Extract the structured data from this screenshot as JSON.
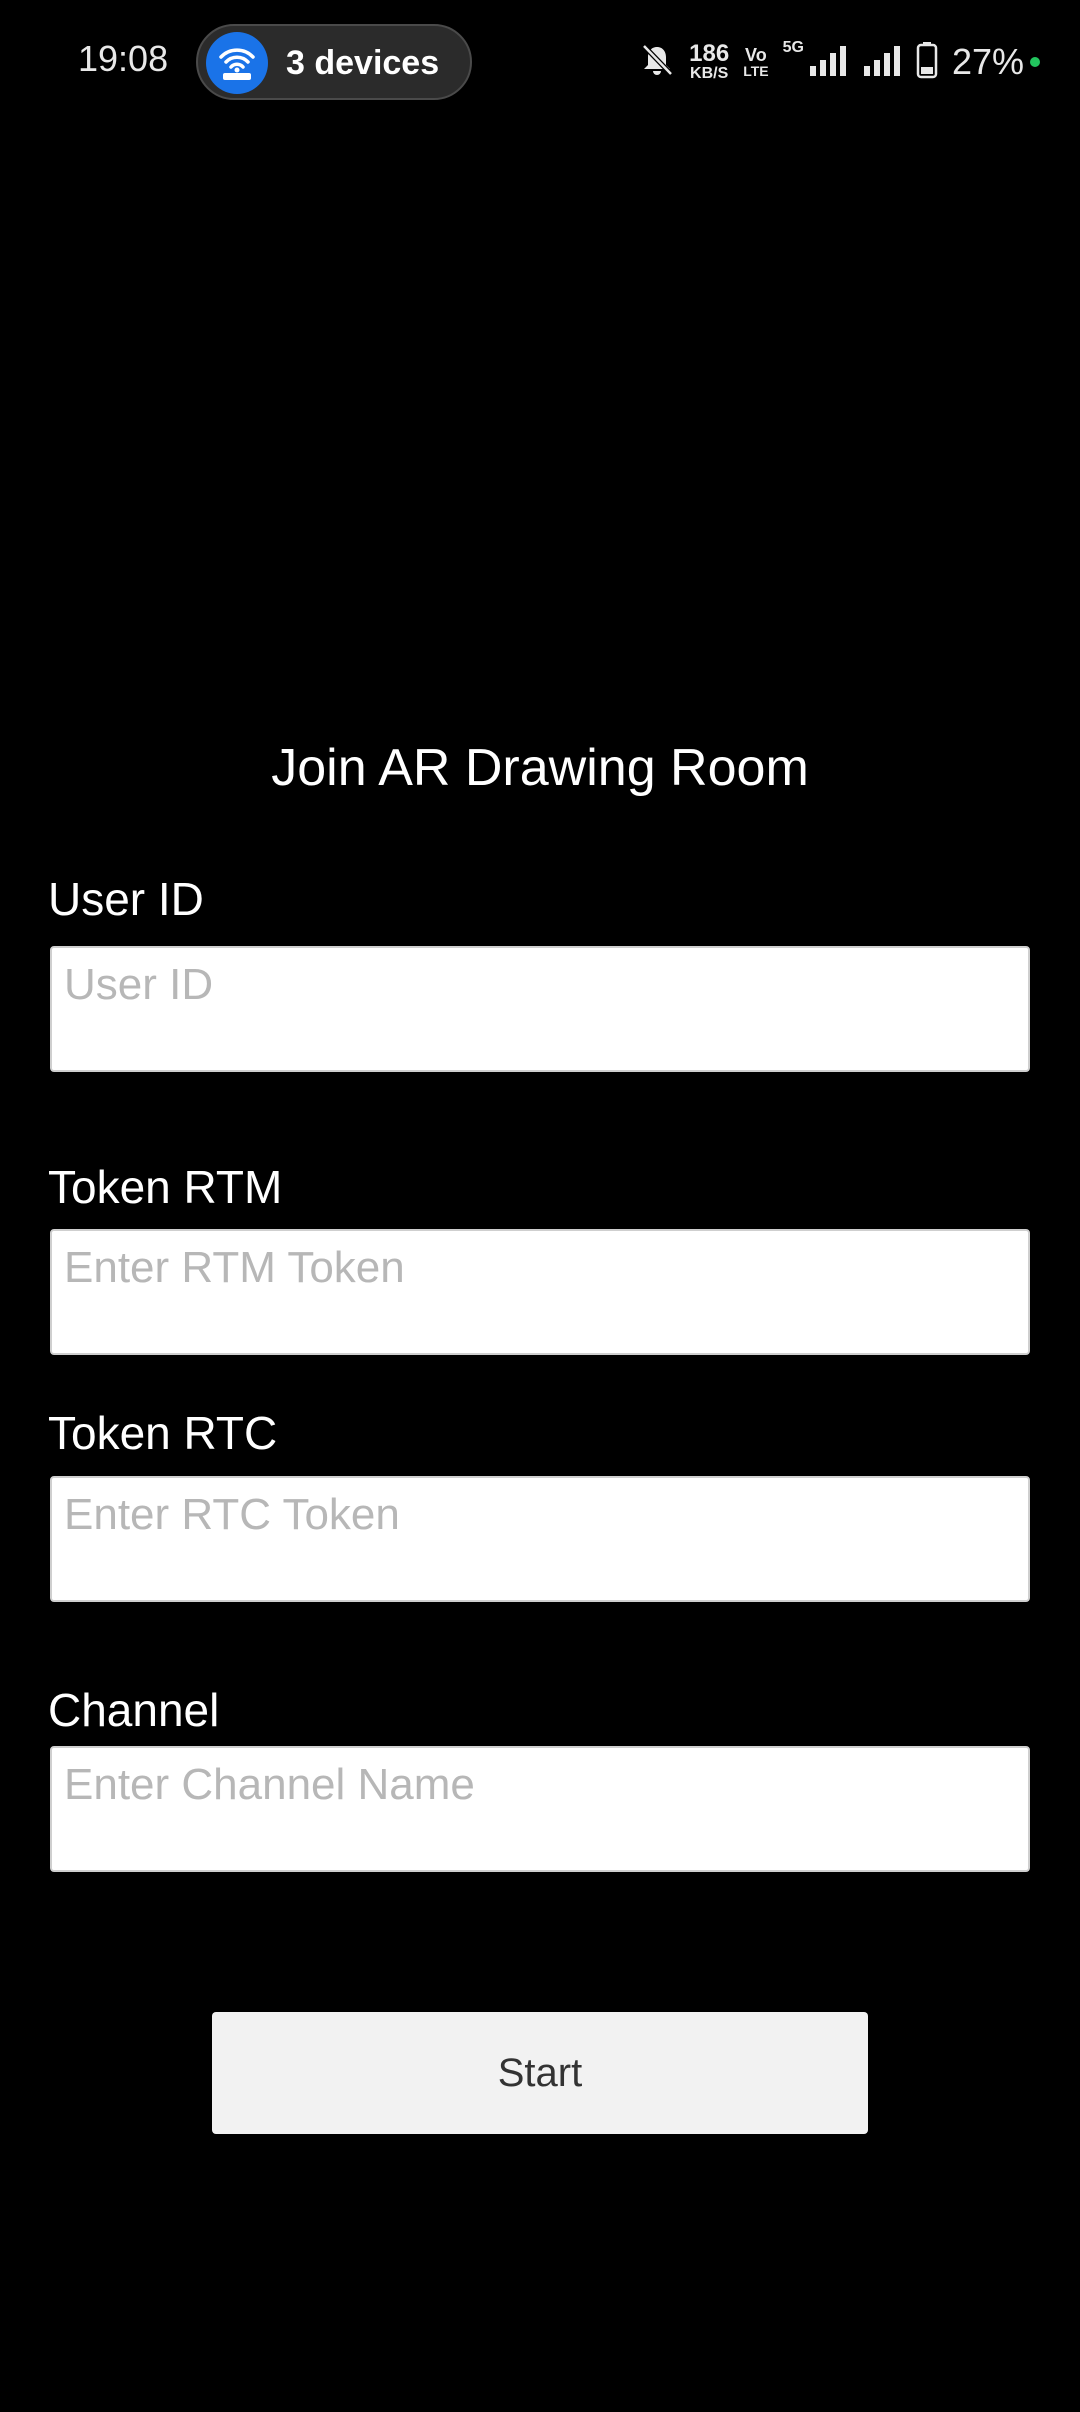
{
  "status_bar": {
    "time": "19:08",
    "hotspot_label": "3 devices",
    "net_speed_value": "186",
    "net_speed_unit": "KB/S",
    "volte_top": "Vo",
    "volte_bottom": "LTE",
    "network_type": "5G",
    "battery_percent": "27%",
    "icons": [
      "wifi-hotspot-icon",
      "bell-muted-icon",
      "signal-bars-icon",
      "battery-icon"
    ],
    "colors": {
      "hotspot_icon_bg": "#1a73e8",
      "charging_dot": "#22c55e"
    }
  },
  "form": {
    "title": "Join AR Drawing Room",
    "user_id": {
      "label": "User ID",
      "placeholder": "User ID"
    },
    "token_rtm": {
      "label": "Token RTM",
      "placeholder": "Enter RTM Token"
    },
    "token_rtc": {
      "label": "Token RTC",
      "placeholder": "Enter RTC Token"
    },
    "channel": {
      "label": "Channel",
      "placeholder": "Enter Channel Name"
    },
    "start_label": "Start"
  }
}
